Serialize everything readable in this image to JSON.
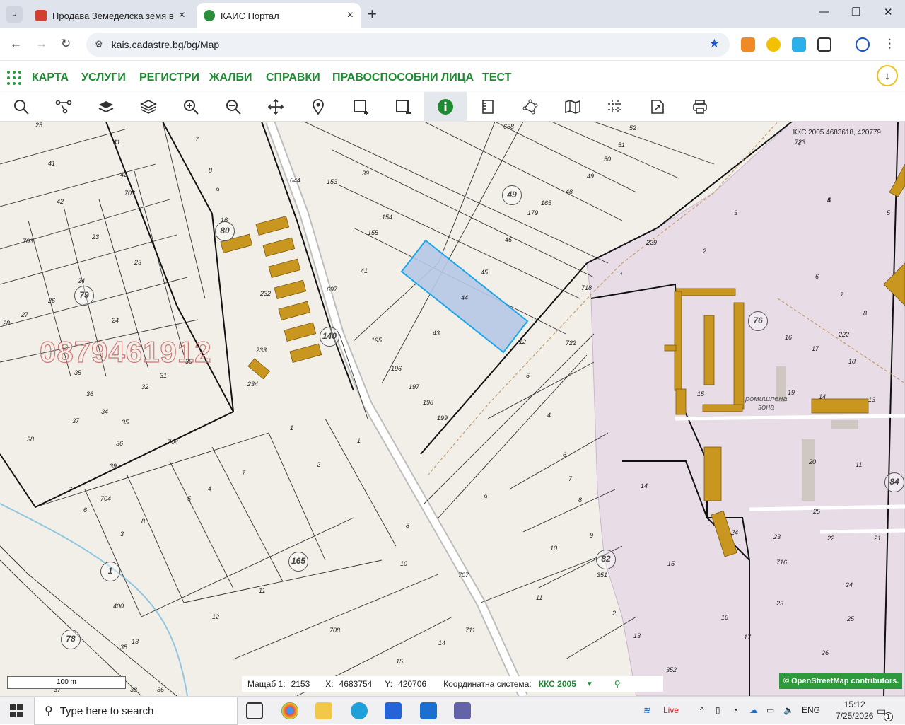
{
  "browser": {
    "tabs": [
      {
        "title": "Продава Земеделска земя в С",
        "favicon_color": "#d23f31",
        "active": false
      },
      {
        "title": "КАИС Портал",
        "favicon_color": "#2b8f3c",
        "active": true
      }
    ],
    "url": "kais.cadastre.bg/bg/Map",
    "new_tab": "+",
    "window_controls": {
      "minimize": "—",
      "restore": "❐",
      "close": "✕"
    }
  },
  "site_nav": {
    "menu": [
      "КАРТА",
      "УСЛУГИ",
      "РЕГИСТРИ",
      "ЖАЛБИ",
      "СПРАВКИ",
      "ПРАВОСПОСОБНИ ЛИЦА",
      "ТЕСТ"
    ],
    "download_icon": "download-icon"
  },
  "toolbar": {
    "tools": [
      "search-icon",
      "route-icon",
      "layers-filled-icon",
      "layers-icon",
      "zoom-in-icon",
      "zoom-out-icon",
      "pan-icon",
      "location-icon",
      "add-area-icon",
      "remove-area-icon",
      "info-icon",
      "measure-icon",
      "polygon-icon",
      "map-icon",
      "grid-icon",
      "export-icon",
      "print-icon"
    ],
    "active_tool": "info-icon"
  },
  "map": {
    "top_coord": "ККС 2005 4683618, 420779",
    "watermark": "0879461912",
    "district_label": "ромишлена\nзона",
    "parcel_labels": [
      "25",
      "7",
      "41",
      "8",
      "41",
      "9",
      "42",
      "703",
      "42",
      "23",
      "703",
      "23",
      "26",
      "24",
      "27",
      "24",
      "28",
      "31",
      "30",
      "35",
      "36",
      "32",
      "34",
      "37",
      "35",
      "38",
      "36",
      "704",
      "39",
      "7",
      "704",
      "6",
      "8",
      "5",
      "4",
      "7",
      "3",
      "8",
      "1",
      "2",
      "9",
      "10",
      "11",
      "12",
      "13",
      "35",
      "36",
      "400",
      "37",
      "38",
      "153",
      "154",
      "155",
      "41",
      "39",
      "644",
      "697",
      "45",
      "46",
      "44",
      "43",
      "195",
      "196",
      "197",
      "198",
      "199",
      "179",
      "165",
      "48",
      "49",
      "50",
      "51",
      "52",
      "658",
      "2",
      "3",
      "1",
      "4",
      "5",
      "6",
      "7",
      "8",
      "16",
      "17",
      "18",
      "15",
      "14",
      "13",
      "19",
      "20",
      "11",
      "14",
      "15",
      "25",
      "24",
      "23",
      "22",
      "21",
      "716",
      "23",
      "24",
      "25",
      "16",
      "17",
      "26",
      "352",
      "13",
      "12",
      "722",
      "5",
      "4",
      "6",
      "7",
      "8",
      "9",
      "10",
      "351",
      "11",
      "2",
      "1",
      "708",
      "707",
      "711",
      "14",
      "15",
      "16",
      "232",
      "233",
      "234",
      "229",
      "718",
      "222",
      "723",
      "4",
      "5",
      "27"
    ],
    "circle_labels": [
      "80",
      "79",
      "140",
      "49",
      "76",
      "165",
      "1",
      "78",
      "82",
      "84"
    ],
    "scale_label": "100 m"
  },
  "status": {
    "scale_label": "Мащаб 1:",
    "scale_value": "2153",
    "x_label": "X:",
    "x_value": "4683754",
    "y_label": "Y:",
    "y_value": "420706",
    "crs_label": "Координатна система:",
    "crs_value": "ККС 2005"
  },
  "attribution": "© OpenStreetMap contributors.",
  "taskbar": {
    "search_placeholder": "Type here to search",
    "live_label": "Live",
    "lang": "ENG",
    "time": "15:12",
    "date": "7/25/2026",
    "notification_count": "1"
  }
}
